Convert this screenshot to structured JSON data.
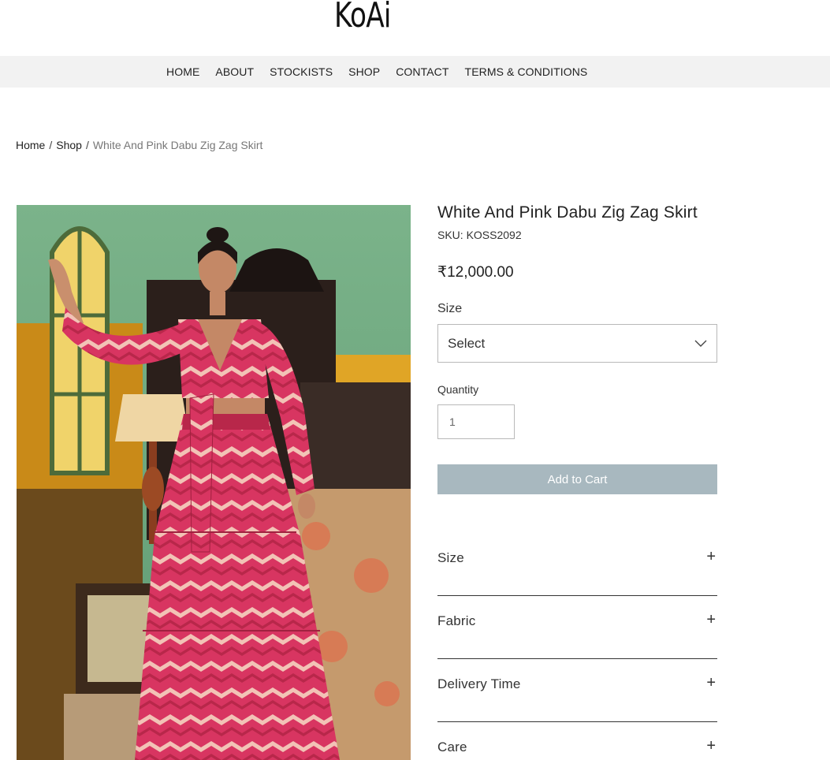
{
  "brand": {
    "logo": "KoAi"
  },
  "nav": {
    "items": [
      {
        "label": "HOME"
      },
      {
        "label": "ABOUT"
      },
      {
        "label": "STOCKISTS"
      },
      {
        "label": "SHOP"
      },
      {
        "label": "CONTACT"
      },
      {
        "label": "TERMS & CONDITIONS"
      }
    ]
  },
  "breadcrumb": {
    "home": "Home",
    "shop": "Shop",
    "current": "White And Pink Dabu Zig Zag Skirt",
    "separator": "/"
  },
  "product": {
    "title": "White And Pink Dabu Zig Zag Skirt",
    "sku": "SKU: KOSS2092",
    "price": "₹12,000.00",
    "size_label": "Size",
    "size_select": "Select",
    "quantity_label": "Quantity",
    "quantity_value": "1",
    "add_to_cart": "Add to Cart",
    "image_alt_icon": "product-photo"
  },
  "accordion": [
    {
      "label": "Size",
      "icon": "plus-icon"
    },
    {
      "label": "Fabric",
      "icon": "plus-icon"
    },
    {
      "label": "Delivery Time",
      "icon": "plus-icon"
    },
    {
      "label": "Care",
      "icon": "plus-icon"
    }
  ],
  "colors": {
    "nav_bg": "#f2f2f2",
    "cart_button": "#a8b8bf",
    "dress_pink": "#d33a5c"
  }
}
